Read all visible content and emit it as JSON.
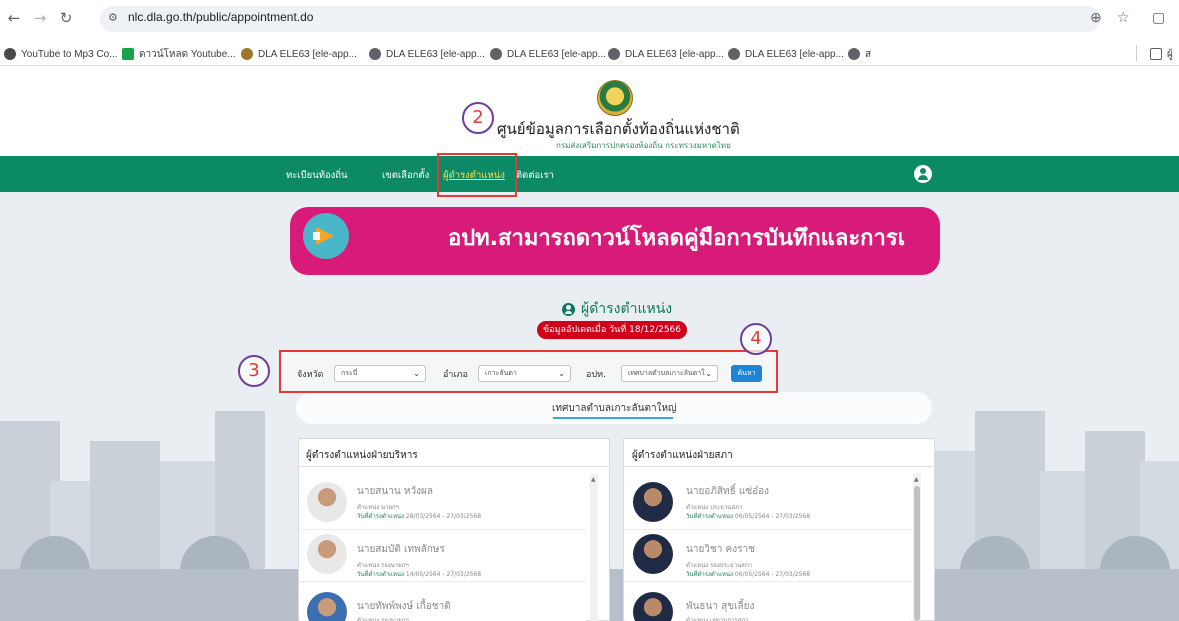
{
  "browser": {
    "url": "nlc.dla.go.th/public/appointment.do",
    "bookmarks": [
      "YouTube to Mp3 Co...",
      "ดาวน์โหลด Youtube...",
      "DLA ELE63 [ele-app...",
      "DLA ELE63 [ele-app...",
      "DLA ELE63 [ele-app...",
      "DLA ELE63 [ele-app...",
      "DLA ELE63 [ele-app...",
      "ส",
      "ผู้"
    ]
  },
  "site": {
    "title": "ศูนย์ข้อมูลการเลือกตั้งท้องถิ่นแห่งชาติ",
    "subtitle": "กรมส่งเสริมการปกครองท้องถิ่น กระทรวงมหาดไทย"
  },
  "nav": {
    "items": [
      "ทะเบียนท้องถิ่น",
      "เขตเลือกตั้ง",
      "ผู้ดำรงตำแหน่ง",
      "ติดต่อเรา"
    ]
  },
  "banner": {
    "text": "อปท.สามารถดาวน์โหลดคู่มือการบันทึกและการเ"
  },
  "section": {
    "heading": "ผู้ดำรงตำแหน่ง",
    "update": "ข้อมูลอัปเดตเมื่อ วันที่ 18/12/2566"
  },
  "filters": {
    "province_label": "จังหวัด",
    "province_value": "กระบี่",
    "district_label": "อำเภอ",
    "district_value": "เกาะลันตา",
    "org_label": "อปท.",
    "org_value": "เทศบาลตำบลเกาะลันตาใ",
    "search_label": "ค้นหา"
  },
  "org": {
    "name": "เทศบาลตำบลเกาะลันตาใหญ่"
  },
  "executive": {
    "title": "ผู้ดำรงตำแหน่งฝ่ายบริหาร",
    "people": [
      {
        "name": "นายสนาน หวังผล",
        "role": "ตำแหน่ง นายกฯ",
        "term_label": "วันที่ดำรงตำแหน่ง",
        "term": "28/03/2564 - 27/03/2568"
      },
      {
        "name": "นายสมบัติ เทพลักษร",
        "role": "ตำแหน่ง รองนายกฯ",
        "term_label": "วันที่ดำรงตำแหน่ง",
        "term": "14/05/2564 - 27/03/2568"
      },
      {
        "name": "นายทัพพ์พงษ์ เกื้อชาติ",
        "role": "ตำแหน่ง รองนายกฯ",
        "term_label": "",
        "term": ""
      }
    ]
  },
  "council": {
    "title": "ผู้ดำรงตำแหน่งฝ่ายสภา",
    "people": [
      {
        "name": "นายอภิสิทธิ์ แซ่อ๋อง",
        "role": "ตำแหน่ง ประธานสภา",
        "term_label": "วันที่ดำรงตำแหน่ง",
        "term": "06/05/2564 - 27/03/2568"
      },
      {
        "name": "นายวิชา คงราช",
        "role": "ตำแหน่ง รองประธานสภา",
        "term_label": "วันที่ดำรงตำแหน่ง",
        "term": "06/05/2564 - 27/03/2568"
      },
      {
        "name": "พันธนา สุขเลี้ยง",
        "role": "ตำแหน่ง เลขานุการสภา",
        "term_label": "",
        "term": ""
      }
    ]
  },
  "annotations": [
    "2",
    "3",
    "4"
  ]
}
